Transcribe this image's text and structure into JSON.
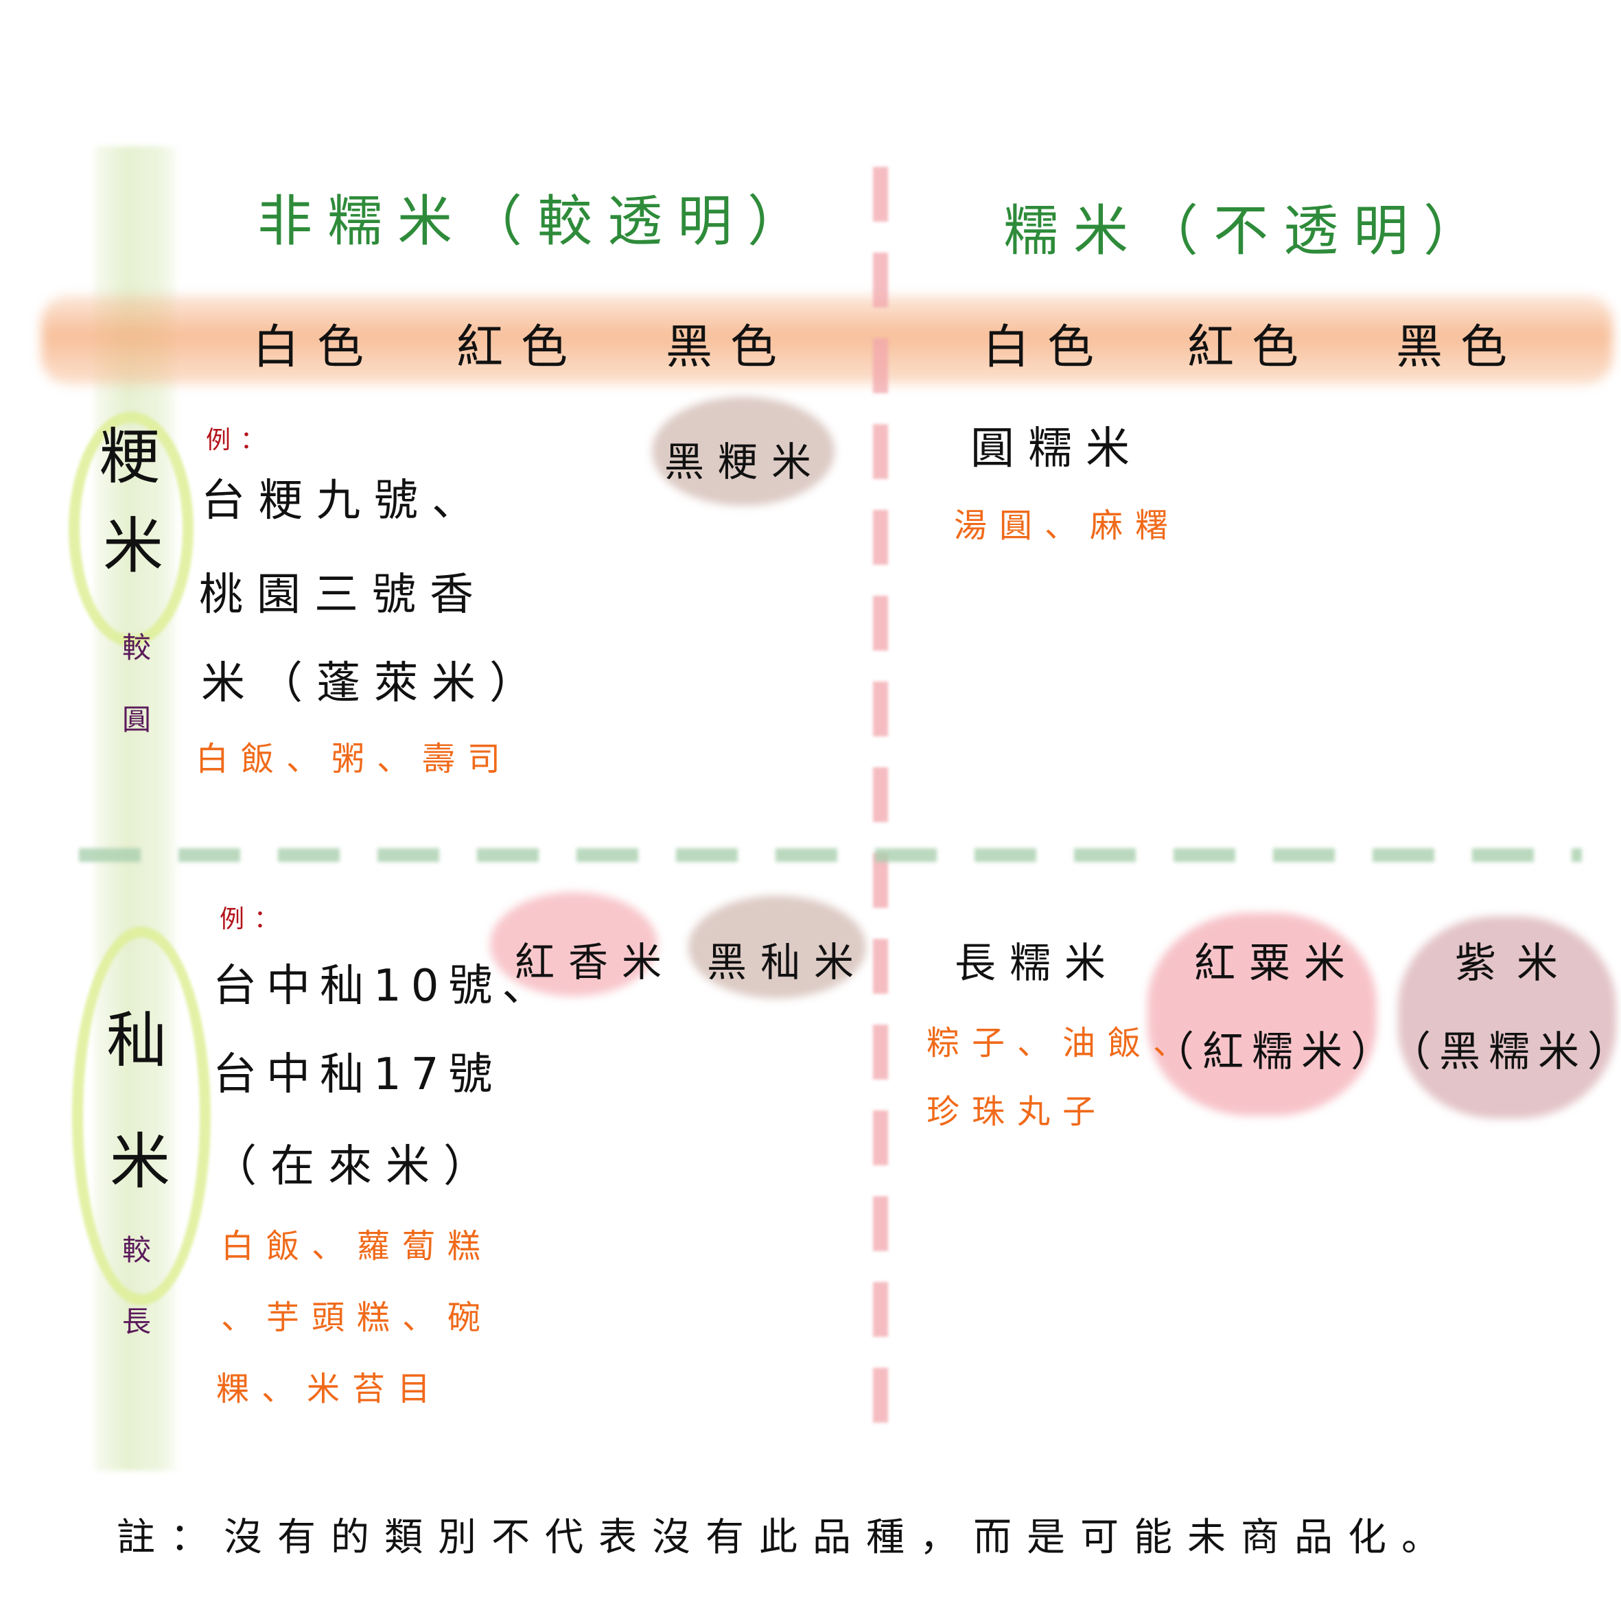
{
  "headers": {
    "non_glutinous": "非糯米（較透明）",
    "glutinous": "糯米（不透明）"
  },
  "colors": {
    "left": [
      "白色",
      "紅色",
      "黑色"
    ],
    "right": [
      "白色",
      "紅色",
      "黑色"
    ]
  },
  "rows": {
    "japonica": {
      "label_1": "粳",
      "label_2": "米",
      "shape_1": "較",
      "shape_2": "圓",
      "example_label": "例：",
      "examples": [
        "台粳九號、",
        "桃園三號香",
        "米（蓬萊米）"
      ],
      "uses": "白飯、粥、壽司",
      "black": "黑粳米",
      "glutinous_white": "圓糯米",
      "glutinous_uses": "湯圓、麻糬"
    },
    "indica": {
      "label_1": "秈",
      "label_2": "米",
      "shape_1": "較",
      "shape_2": "長",
      "example_label": "例：",
      "examples": [
        "台中秈10號、",
        "台中秈17號",
        "（在來米）"
      ],
      "uses": [
        "白飯、蘿蔔糕",
        "、芋頭糕、碗",
        "粿、米苔目"
      ],
      "red": "紅香米",
      "black": "黑秈米",
      "glutinous_white": "長糯米",
      "glutinous_uses": [
        "粽子、油飯、",
        "珍珠丸子"
      ],
      "glutinous_red": "紅粟米",
      "glutinous_red_alt": "（紅糯米）",
      "glutinous_black": "紫米",
      "glutinous_black_alt": "（黑糯米）"
    }
  },
  "note": "註：沒有的類別不代表沒有此品種，而是可能未商品化。",
  "palette": {
    "header_green": "#2e8b3a",
    "band_orange": "#f5b48a",
    "band_green": "#e6f0d0",
    "divider_pink": "#f2a7ad",
    "divider_green": "#a9cfae",
    "use_orange": "#f06a1a",
    "example_red": "#b3121b",
    "blob_brown": "#d7c2bb",
    "blob_pink": "#f6b9bf",
    "blob_mauve": "#dcb5ba"
  }
}
